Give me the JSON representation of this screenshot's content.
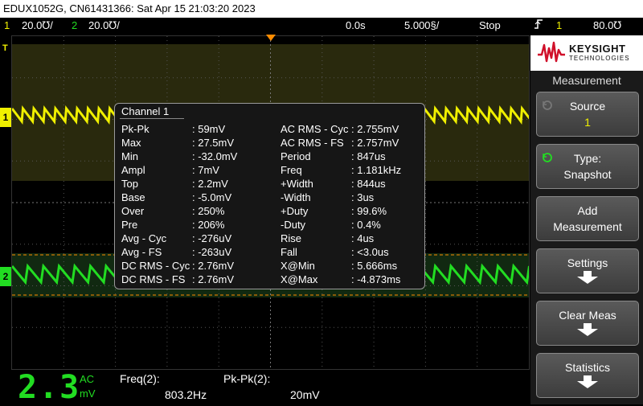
{
  "title": "EDUX1052G, CN61431366: Sat Apr 15 21:03:20 2023",
  "status": {
    "ch1_num": "1",
    "ch1_scale": "20.0℧/",
    "ch2_num": "2",
    "ch2_scale": "20.0℧/",
    "time_pos": "0.0s",
    "time_scale": "5.000§/",
    "run_state": "Stop",
    "trig_icon": "trigger-rising-edge-icon",
    "trig_src": "1",
    "trig_level": "80.0℧"
  },
  "colors": {
    "ch1": "#f0f000",
    "ch2": "#22dd22",
    "grid": "#555555",
    "trigger": "#ff8c00"
  },
  "markers": {
    "ch1": "1",
    "ch2": "2",
    "trigger": "T"
  },
  "popup": {
    "header": "Channel 1",
    "left": [
      {
        "label": "Pk-Pk",
        "value": ": 59mV"
      },
      {
        "label": "Max",
        "value": ": 27.5mV"
      },
      {
        "label": "Min",
        "value": ": -32.0mV"
      },
      {
        "label": "Ampl",
        "value": ": 7mV"
      },
      {
        "label": "Top",
        "value": ": 2.2mV"
      },
      {
        "label": "Base",
        "value": ": -5.0mV"
      },
      {
        "label": "Over",
        "value": ": 250%"
      },
      {
        "label": "Pre",
        "value": ": 206%"
      },
      {
        "label": "Avg - Cyc",
        "value": ": -276uV"
      },
      {
        "label": "Avg - FS",
        "value": ": -263uV"
      },
      {
        "label": "DC RMS - Cyc",
        "value": ": 2.76mV"
      },
      {
        "label": "DC RMS - FS",
        "value": ": 2.76mV"
      }
    ],
    "right": [
      {
        "label": "AC RMS - Cyc",
        "value": ": 2.755mV"
      },
      {
        "label": "AC RMS - FS",
        "value": ": 2.757mV"
      },
      {
        "label": "Period",
        "value": ": 847us"
      },
      {
        "label": "Freq",
        "value": ": 1.181kHz"
      },
      {
        "label": "+Width",
        "value": ": 844us"
      },
      {
        "label": "-Width",
        "value": ": 3us"
      },
      {
        "label": "+Duty",
        "value": ": 99.6%"
      },
      {
        "label": "-Duty",
        "value": ": 0.4%"
      },
      {
        "label": "Rise",
        "value": ": 4us"
      },
      {
        "label": "Fall",
        "value": ":  <3.0us"
      },
      {
        "label": "X@Min",
        "value": ": 5.666ms"
      },
      {
        "label": "X@Max",
        "value": ": -4.873ms"
      }
    ]
  },
  "panel": {
    "brand": "KEYSIGHT",
    "brand_sub": "TECHNOLOGIES",
    "title": "Measurement",
    "softkeys": [
      {
        "line1": "Source",
        "line2": "1"
      },
      {
        "line1": "Type:",
        "line2": "Snapshot"
      },
      {
        "line1": "Add",
        "line2": "Measurement"
      },
      {
        "line1": "Settings",
        "line2": ""
      },
      {
        "line1": "Clear Meas",
        "line2": ""
      },
      {
        "line1": "Statistics",
        "line2": ""
      }
    ]
  },
  "bottom": {
    "digits": "2.3",
    "ac": "AC",
    "unit": "mV",
    "m1_label": "Freq(2):",
    "m1_value": "803.2Hz",
    "m2_label": "Pk-Pk(2):",
    "m2_value": "20mV"
  }
}
